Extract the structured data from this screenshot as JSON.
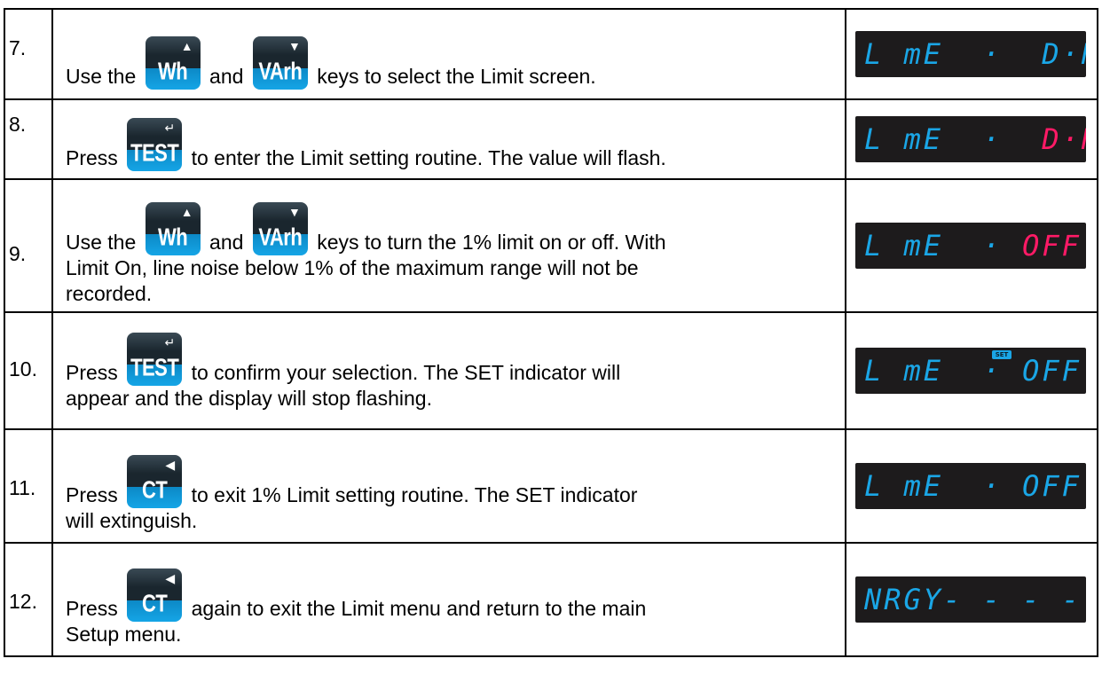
{
  "steps": [
    {
      "num": "7.",
      "before": "Use the",
      "key1": "Wh",
      "mid": "and",
      "key2": "VArh",
      "after": "keys to select the Limit screen.",
      "display_left": "L mE  ·  ",
      "display_right": "D·N",
      "display_right_color": "blue"
    },
    {
      "num": "8.",
      "before": "Press",
      "key1": "TEST",
      "after": "to enter the Limit setting routine.  The value will flash.",
      "display_left": "L mE  ·  ",
      "display_right": "D·N",
      "display_right_color": "pink"
    },
    {
      "num": "9.",
      "before": "Use the",
      "key1": "Wh",
      "mid": "and",
      "key2": "VArh",
      "after": "keys to turn the 1% limit on or off.  With",
      "line2": "Limit On, line noise below 1% of the maximum range will not be",
      "line3": "recorded.",
      "display_left": "L mE  · ",
      "display_right": "OFF",
      "display_right_color": "pink"
    },
    {
      "num": "10.",
      "before": "Press",
      "key1": "TEST",
      "after": "to confirm your selection.  The SET indicator will",
      "line2": "appear and the display will stop flashing.",
      "display_left": "L mE  · ",
      "display_right": "OFF",
      "display_right_color": "blue",
      "set_indicator": "SET"
    },
    {
      "num": "11.",
      "before": "Press",
      "key1": "CT",
      "after": "to exit 1% Limit setting routine.  The SET indicator",
      "line2": "will extinguish.",
      "display_left": "L mE  · ",
      "display_right": "OFF",
      "display_right_color": "blue"
    },
    {
      "num": "12.",
      "before": "Press",
      "key1": "CT",
      "after": "again to exit the Limit menu and return to the main",
      "line2": "Setup menu.",
      "display_left": "NRGY",
      "display_right": "- - - -",
      "display_right_color": "blue"
    }
  ],
  "key_arrows": {
    "up": "▲",
    "down": "▼",
    "enter": "↵",
    "left": "◀"
  },
  "colors": {
    "display_blue": "#1aa6e6",
    "display_pink": "#ff1a66",
    "display_bg": "#1d1b1c",
    "key_blue": "#15a5e6"
  }
}
